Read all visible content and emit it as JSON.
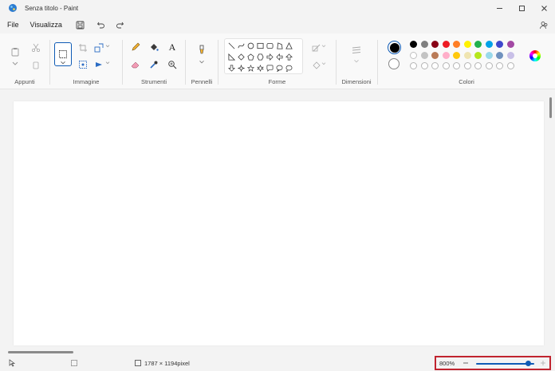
{
  "window": {
    "title": "Senza titolo - Paint"
  },
  "menu": {
    "file": "File",
    "view": "Visualizza"
  },
  "ribbon": {
    "groups": {
      "clipboard": "Appunti",
      "image": "Immagine",
      "tools": "Strumenti",
      "brushes": "Pennelli",
      "shapes": "Forme",
      "size": "Dimensioni",
      "colors": "Colori"
    },
    "text_tool_glyph": "A"
  },
  "colors": {
    "primary": "#000000",
    "secondary": "#ffffff",
    "palette_row1": [
      "#000000",
      "#7f7f7f",
      "#880015",
      "#ed1c24",
      "#ff7f27",
      "#fff200",
      "#22b14c",
      "#00a2e8",
      "#3f48cc",
      "#a349a4"
    ],
    "palette_row2": [
      "#ffffff",
      "#c3c3c3",
      "#b97a57",
      "#ffaec9",
      "#ffc90e",
      "#efe4b0",
      "#b5e61d",
      "#99d9ea",
      "#7092be",
      "#c8bfe7"
    ],
    "accent": "#0f5bb5",
    "highlight": "#c0242f"
  },
  "status": {
    "canvas_size": "1787 × 1194pixel",
    "zoom": "800%",
    "zoom_level_fraction": 0.9
  }
}
